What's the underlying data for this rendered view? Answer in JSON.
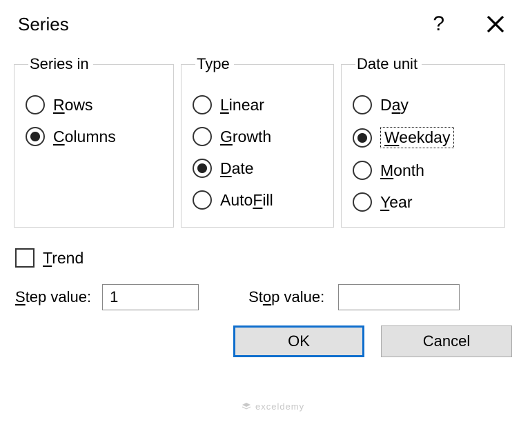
{
  "title": "Series",
  "groups": {
    "seriesin": {
      "legend": "Series in",
      "options": [
        {
          "label": "Rows",
          "underlineChar": "R",
          "checked": false
        },
        {
          "label": "Columns",
          "underlineChar": "C",
          "checked": true
        }
      ]
    },
    "type": {
      "legend": "Type",
      "options": [
        {
          "label": "Linear",
          "underlineChar": "L",
          "checked": false
        },
        {
          "label": "Growth",
          "underlineChar": "G",
          "checked": false
        },
        {
          "label": "Date",
          "underlineChar": "D",
          "checked": true
        },
        {
          "label": "AutoFill",
          "underlineChar": "F",
          "underlineIndex": 4,
          "checked": false
        }
      ]
    },
    "dateunit": {
      "legend": "Date unit",
      "options": [
        {
          "label": "Day",
          "underlineChar": "a",
          "underlineIndex": 1,
          "checked": false
        },
        {
          "label": "Weekday",
          "underlineChar": "W",
          "checked": true,
          "focused": true
        },
        {
          "label": "Month",
          "underlineChar": "M",
          "checked": false
        },
        {
          "label": "Year",
          "underlineChar": "Y",
          "checked": false
        }
      ]
    }
  },
  "trend": {
    "label": "Trend",
    "underlineChar": "T",
    "checked": false
  },
  "step": {
    "label": "Step value:",
    "underlineChar": "S",
    "value": "1"
  },
  "stop": {
    "label": "Stop value:",
    "underlineChar": "o",
    "underlineIndex": 2,
    "value": ""
  },
  "buttons": {
    "ok": "OK",
    "cancel": "Cancel"
  },
  "watermark": "exceldemy"
}
